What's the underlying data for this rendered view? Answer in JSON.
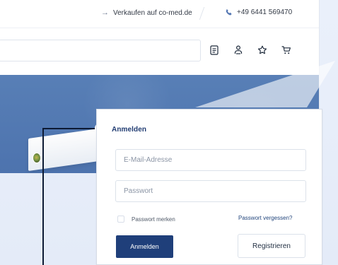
{
  "topbar": {
    "sell_text": "Verkaufen auf co-med.de",
    "phone_text": "+49 6441 569470",
    "arrow_icon": "arrow-right-icon",
    "phone_icon": "phone-icon"
  },
  "header": {
    "search": {
      "value": "",
      "placeholder": ""
    },
    "icons": [
      "document-icon",
      "account-icon",
      "star-icon",
      "cart-icon"
    ]
  },
  "login": {
    "title": "Anmelden",
    "email_placeholder": "E-Mail-Adresse",
    "password_placeholder": "Passwort",
    "remember_label": "Passwort merken",
    "forgot_label": "Passwort vergessen?",
    "login_button": "Anmelden",
    "register_button": "Registrieren"
  },
  "colors": {
    "brand_blue": "#1f3f7a",
    "hero_blue": "#587fb6",
    "page_background": "#e6edf9",
    "link_blue": "#24477d"
  }
}
